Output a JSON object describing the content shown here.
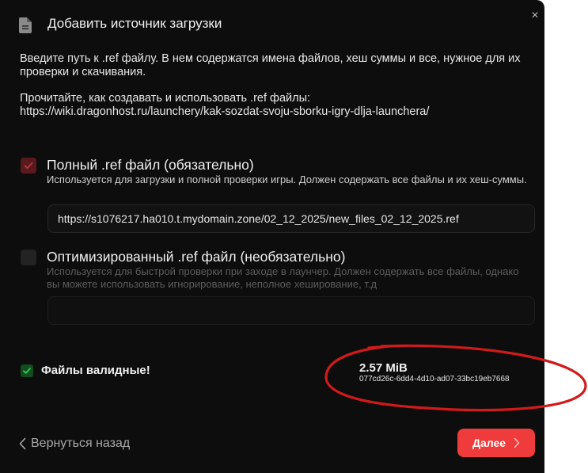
{
  "dialog": {
    "title": "Добавить источник загрузки",
    "header_icon": "document-icon",
    "close_icon": "close-icon",
    "close_label": "×"
  },
  "intro": {
    "line1": "Введите путь к .ref файлу. В нем содержатся имена файлов, хеш суммы и все, нужное для их проверки и скачивания.",
    "line2": "Прочитайте, как создавать и использовать .ref файлы:",
    "link": "https://wiki.dragonhost.ru/launchery/kak-sozdat-svoju-sborku-igry-dlja-launchera/"
  },
  "full_ref": {
    "checked": true,
    "title": "Полный .ref файл (обязательно)",
    "description": "Используется для загрузки и полной проверки игры. Должен содержать все файлы и их хеш-суммы.",
    "value": "https://s1076217.ha010.t.mydomain.zone/02_12_2025/new_files_02_12_2025.ref"
  },
  "optimized_ref": {
    "checked": false,
    "title": "Оптимизированный .ref файл (необязательно)",
    "description": "Используется для быстрой проверки при заходе в лаунчер. Должен содержать все файлы, однако вы можете использовать игнорирование, неполное хеширование, т.д",
    "value": ""
  },
  "validation": {
    "checked": true,
    "text": "Файлы валидные!",
    "size": "2.57 MiB",
    "hash": "077cd26c-6dd4-4d10-ad07-33bc19eb7668"
  },
  "footer": {
    "back_label": "Вернуться назад",
    "next_label": "Далее",
    "back_icon": "chevron-left-icon",
    "next_icon": "chevron-right-icon"
  },
  "colors": {
    "dialog_bg": "#0d0d0d",
    "accent": "#ef3b3b",
    "success": "#2fbf4f",
    "annotation": "#d11a1a"
  }
}
